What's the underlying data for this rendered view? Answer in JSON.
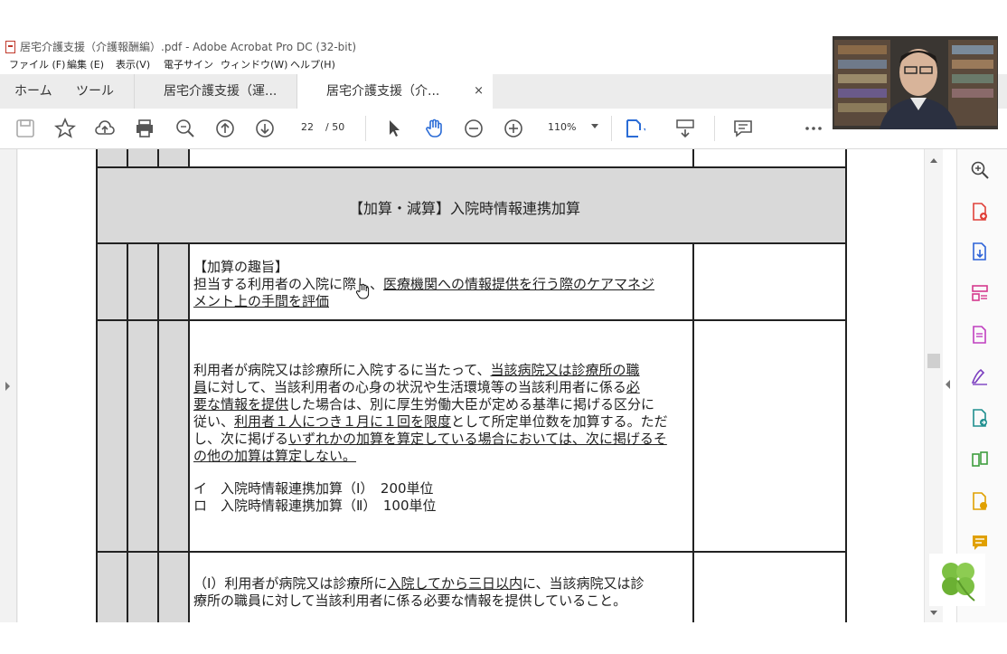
{
  "window": {
    "title": "居宅介護支援（介護報酬編）.pdf - Adobe Acrobat Pro DC (32-bit)"
  },
  "menu": [
    "ファイル (F)",
    "編集 (E)",
    "表示(V)",
    "電子サイン",
    "ウィンドウ(W)",
    "ヘルプ(H)"
  ],
  "tabs": {
    "home": "ホーム",
    "tools": "ツール",
    "doc1": "居宅介護支援（運...",
    "doc2": "居宅介護支援（介...",
    "close": "×"
  },
  "toolbar": {
    "page_current": "22",
    "page_total": "/ 50",
    "zoom": "110%"
  },
  "document": {
    "section_title": "【加算・減算】入院時情報連携加算",
    "purpose_heading": "【加算の趣旨】",
    "purpose_line1_a": "担当する利用者の入院に際し、",
    "purpose_line1_b": "医療機関への情報提供を行う際のケアマネジ",
    "purpose_line2": "メント上の手間を評価",
    "p1": [
      {
        "a": "利用者が病院又は診療所に入院するに当たって、",
        "b": "当該病院又は診療所の職",
        "c": ""
      },
      {
        "a": "",
        "b": "員",
        "c": "に対して、当該利用者の心身の状況や生活環境等の当該利用者に係る",
        "d": "必"
      },
      {
        "a": "",
        "b": "要な情報を提供",
        "c": "した場合は、別に厚生労働大臣が定める基準に掲げる区分に"
      },
      {
        "a": "従い、",
        "b": "利用者１人につき１月に１回を限度",
        "c": "として所定単位数を加算する。ただ"
      },
      {
        "a": "し、次に掲げる",
        "b": "いずれかの加算を算定している場合においては、次に掲げるそ",
        "c": ""
      },
      {
        "a": "",
        "b": "の他の加算は算定しない。",
        "c": ""
      }
    ],
    "item1": "イ　入院時情報連携加算（Ⅰ）　200単位",
    "item2": "ロ　入院時情報連携加算（Ⅱ）　100単位",
    "cond1_a": "（Ⅰ）利用者が病院又は診療所に",
    "cond1_b": "入院してから三日以内",
    "cond1_c": "に、当該病院又は診",
    "cond2": "療所の職員に対して当該利用者に係る必要な情報を提供していること。"
  }
}
